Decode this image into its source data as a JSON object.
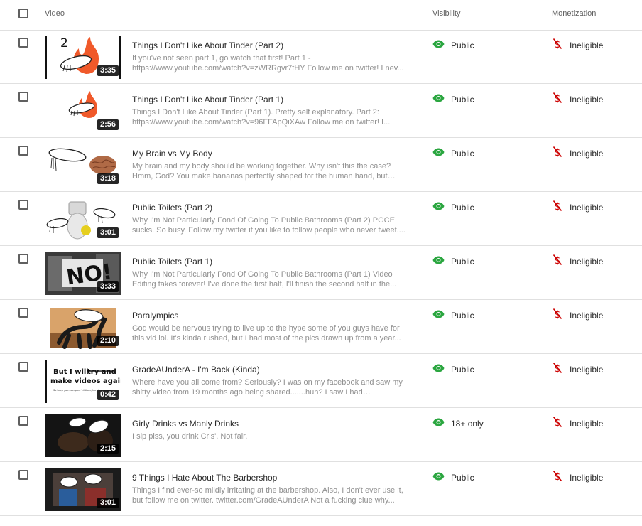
{
  "header": {
    "video": "Video",
    "visibility": "Visibility",
    "monetization": "Monetization"
  },
  "colors": {
    "visibility_icon": "#2ba640",
    "monetization_icon": "#cc0000"
  },
  "icons": {
    "visibility": "eye-icon",
    "monetization": "dollar-off-icon"
  },
  "videos": [
    {
      "title": "Things I Don't Like About Tinder (Part 2)",
      "description": "If you've not seen part 1, go watch that first! Part 1 - https://www.youtube.com/watch?v=zWRRgvr7tHY Follow me on twitter! I nev...",
      "duration": "3:35",
      "visibility": "Public",
      "monetization": "Ineligible"
    },
    {
      "title": "Things I Don't Like About Tinder (Part 1)",
      "description": "Things I Don't Like About Tinder (Part 1). Pretty self explanatory. Part 2: https://www.youtube.com/watch?v=96FFApQiXAw Follow me on twitter! I...",
      "duration": "2:56",
      "visibility": "Public",
      "monetization": "Ineligible"
    },
    {
      "title": "My Brain vs My Body",
      "description": "My brain and my body should be working together. Why isn't this the case? Hmm, God? You make bananas perfectly shaped for the human hand, but you...",
      "duration": "3:18",
      "visibility": "Public",
      "monetization": "Ineligible"
    },
    {
      "title": "Public Toilets (Part 2)",
      "description": "Why I'm Not Particularly Fond Of Going To Public Bathrooms (Part 2) PGCE sucks. So busy. Follow my twitter if you like to follow people who never tweet....",
      "duration": "3:01",
      "visibility": "Public",
      "monetization": "Ineligible"
    },
    {
      "title": "Public Toilets (Part 1)",
      "description": "Why I'm Not Particularly Fond Of Going To Public Bathrooms (Part 1) Video Editing takes forever! I've done the first half, I'll finish the second half in the...",
      "duration": "3:33",
      "visibility": "Public",
      "monetization": "Ineligible"
    },
    {
      "title": "Paralympics",
      "description": "God would be nervous trying to live up to the hype some of you guys have for this vid lol. It's kinda rushed, but I had most of the pics drawn up from a year...",
      "duration": "2:10",
      "visibility": "Public",
      "monetization": "Ineligible"
    },
    {
      "title": "GradeAUnderA - I'm Back (Kinda)",
      "description": "Where have you all come from? Seriously? I was on my facebook and saw my shitty video from 19 months ago being shared.......huh? I saw I had subscriber...",
      "duration": "0:42",
      "visibility": "Public",
      "monetization": "Ineligible",
      "thumb_text": {
        "line1": "But I will",
        "strike": "try and",
        "line2": "make videos again",
        "small": "So keep you occupied 'til then, here's a crappy"
      }
    },
    {
      "title": "Girly Drinks vs Manly Drinks",
      "description": "I sip piss, you drink Cris'. Not fair.",
      "duration": "2:15",
      "visibility": "18+ only",
      "monetization": "Ineligible"
    },
    {
      "title": "9 Things I Hate About The Barbershop",
      "description": "Things I find ever-so mildly irritating at the barbershop. Also, I don't ever use it, but follow me on twitter. twitter.com/GradeAUnderA Not a fucking clue why...",
      "duration": "3:01",
      "visibility": "Public",
      "monetization": "Ineligible"
    }
  ]
}
